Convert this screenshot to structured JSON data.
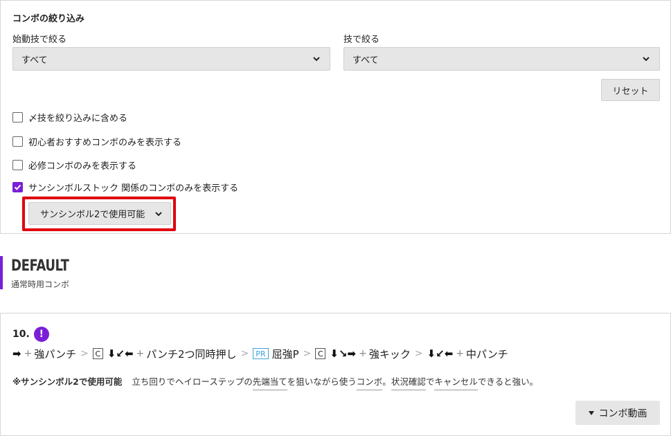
{
  "filter": {
    "title": "コンボの絞り込み",
    "starter_label": "始動技で絞る",
    "starter_value": "すべて",
    "move_label": "技で絞る",
    "move_value": "すべて",
    "reset_label": "リセット",
    "checkboxes": [
      {
        "label": "〆技を絞り込みに含める",
        "checked": false
      },
      {
        "label": "初心者おすすめコンボのみを表示する",
        "checked": false
      },
      {
        "label": "必修コンボのみを表示する",
        "checked": false
      },
      {
        "label": "サンシンボルストック 関係のコンボのみを表示する",
        "checked": true
      }
    ],
    "symbol_value": "サンシンボル2で使用可能"
  },
  "section": {
    "title": "DEFAULT",
    "subtitle": "通常時用コンボ"
  },
  "combo": {
    "number": "10.",
    "alert": "!",
    "steps": {
      "s1_arrows": "➡",
      "s1_move": "強パンチ",
      "c1": "C",
      "s2_arrows": "⬇↙⬅",
      "s2_move": "パンチ2つ同時押し",
      "pr": "PR",
      "s3_move": "屈強P",
      "c2": "C",
      "s4_arrows": "⬇↘➡",
      "s4_move": "強キック",
      "s5_arrows": "⬇↙⬅",
      "s5_move": "中パンチ",
      "plus": "+",
      "sep": ">"
    },
    "note_tag": "※サンシンボル2で使用可能",
    "note_part1": "立ち回りでヘイローステップの",
    "note_u1": "先端当て",
    "note_part2": "を狙いながら使う",
    "note_u2": "コンボ",
    "note_part3": "。",
    "note_u3": "状況確認",
    "note_part4": "で",
    "note_u4": "キャンセル",
    "note_part5": "できると強い。",
    "video_label": "コンボ動画"
  },
  "colors": {
    "accent": "#7a1fd6",
    "highlight": "#e0000f",
    "pr": "#3ea3d9"
  }
}
